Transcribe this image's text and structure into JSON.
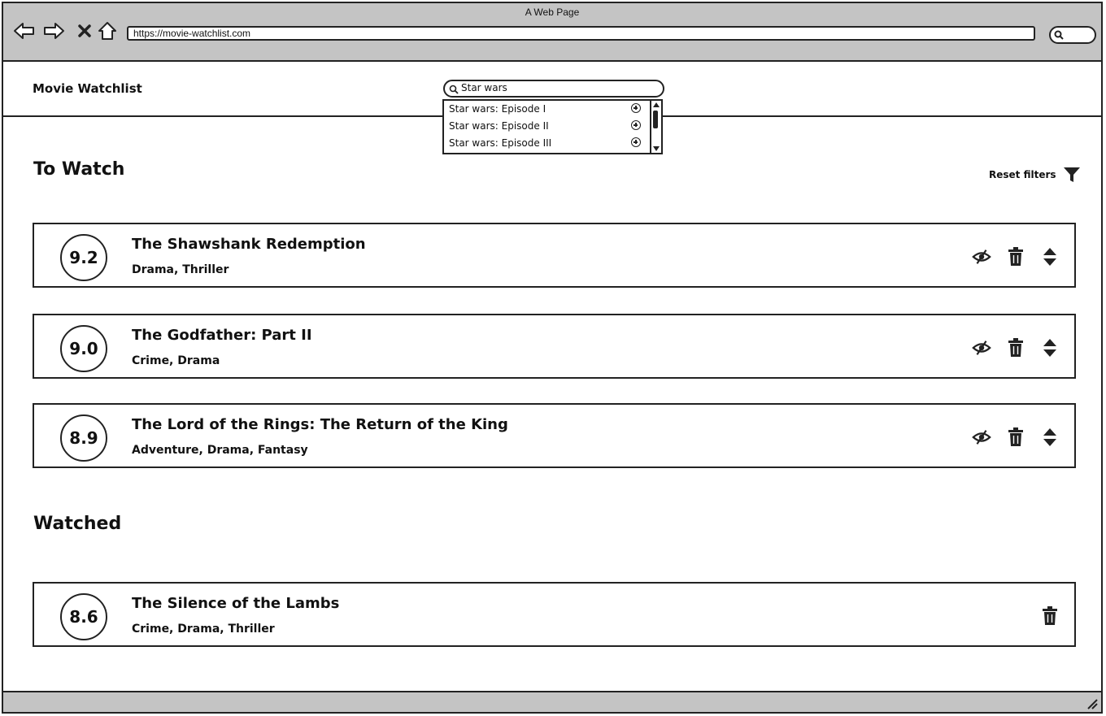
{
  "browser": {
    "window_title": "A Web Page",
    "url": "https://movie-watchlist.com",
    "icons": [
      "back-arrow-icon",
      "forward-arrow-icon",
      "close-icon",
      "home-icon",
      "search-icon"
    ]
  },
  "app": {
    "brand": "Movie Watchlist",
    "search": {
      "value": "Star wars",
      "results": [
        {
          "label": "Star wars: Episode I"
        },
        {
          "label": "Star wars: Episode II"
        },
        {
          "label": "Star wars: Episode III"
        }
      ]
    }
  },
  "to_watch": {
    "heading": "To Watch",
    "reset_label": "Reset filters",
    "movies": [
      {
        "rating": "9.2",
        "title": "The Shawshank Redemption",
        "genres": "Drama, Thriller"
      },
      {
        "rating": "9.0",
        "title": "The Godfather: Part II",
        "genres": "Crime, Drama"
      },
      {
        "rating": "8.9",
        "title": "The Lord of the Rings: The Return of the King",
        "genres": "Adventure, Drama, Fantasy"
      }
    ]
  },
  "watched": {
    "heading": "Watched",
    "movies": [
      {
        "rating": "8.6",
        "title": "The Silence of the Lambs",
        "genres": "Crime, Drama, Thriller"
      }
    ]
  }
}
